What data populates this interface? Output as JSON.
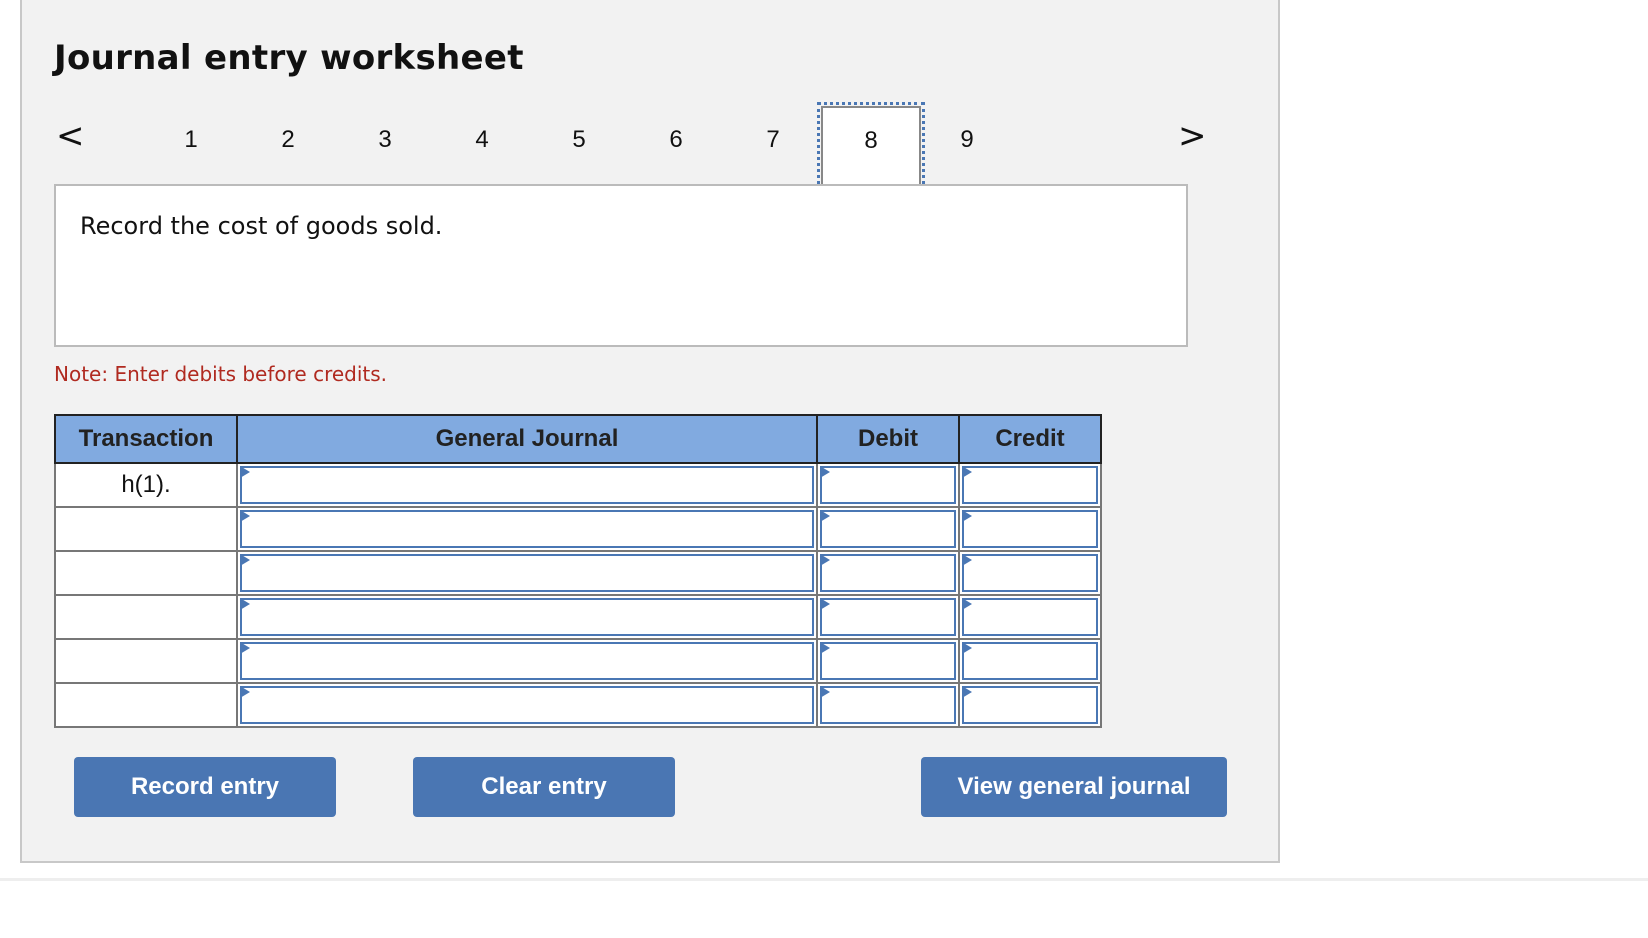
{
  "title": "Journal entry worksheet",
  "nav": {
    "prev_icon": "chevron-left-icon",
    "next_icon": "chevron-right-icon",
    "prev_glyph": "<",
    "next_glyph": ">",
    "steps": [
      "1",
      "2",
      "3",
      "4",
      "5",
      "6",
      "7",
      "8",
      "9"
    ],
    "active_step": "8"
  },
  "description": "Record the cost of goods sold.",
  "note": "Note: Enter debits before credits.",
  "table": {
    "headers": [
      "Transaction",
      "General Journal",
      "Debit",
      "Credit"
    ],
    "rows": [
      {
        "transaction": "h(1).",
        "account": "",
        "debit": "",
        "credit": ""
      },
      {
        "transaction": "",
        "account": "",
        "debit": "",
        "credit": ""
      },
      {
        "transaction": "",
        "account": "",
        "debit": "",
        "credit": ""
      },
      {
        "transaction": "",
        "account": "",
        "debit": "",
        "credit": ""
      },
      {
        "transaction": "",
        "account": "",
        "debit": "",
        "credit": ""
      },
      {
        "transaction": "",
        "account": "",
        "debit": "",
        "credit": ""
      }
    ]
  },
  "buttons": {
    "record": "Record entry",
    "clear": "Clear entry",
    "view": "View general journal"
  },
  "colors": {
    "accent": "#4a76b3",
    "header_bg": "#81aae0",
    "note": "#b02a20",
    "panel_bg": "#f2f2f2"
  }
}
